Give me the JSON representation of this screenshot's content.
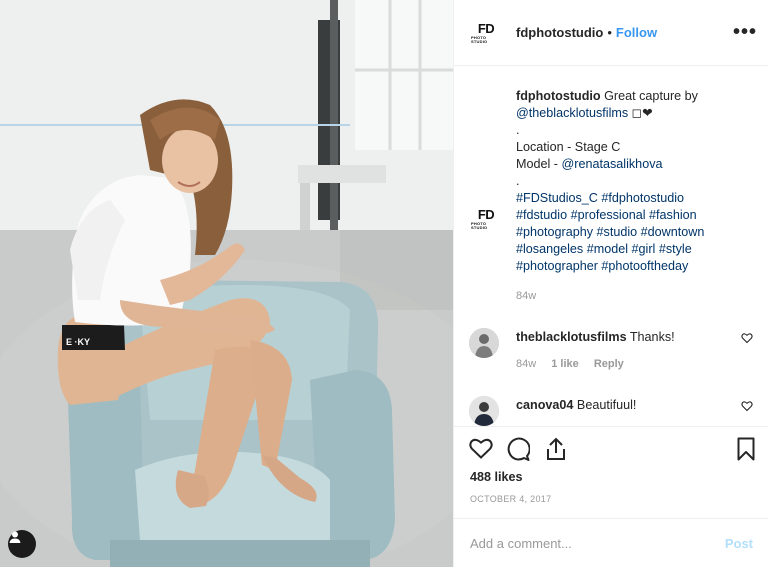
{
  "post": {
    "username": "fdphotostudio",
    "separator": "•",
    "follow_label": "Follow",
    "more_icon": "•••",
    "logo": {
      "big": "FD",
      "small": "PHOTO STUDIO"
    }
  },
  "caption": {
    "username": "fdphotostudio",
    "text_start": " Great capture by",
    "mention": "@theblacklotusfilms",
    "emoji": " ◻❤",
    "dot1": ".",
    "location": "Location - Stage C",
    "model_label": "Model - ",
    "model_mention": "@renatasalikhova",
    "dot2": ".",
    "hashtag_lines": [
      "#FDStudios_C #fdphotostudio",
      "#fdstudio #professional #fashion",
      "#photography #studio #downtown",
      "#losangeles #model #girl #style",
      "#photographer #photooftheday"
    ],
    "age": "84w"
  },
  "comments": [
    {
      "username": "theblacklotusfilms",
      "text": "Thanks!",
      "age": "84w",
      "likes": "1 like",
      "reply": "Reply"
    },
    {
      "username": "canova04",
      "text": "Beautifuul!"
    }
  ],
  "actions": {
    "icons": [
      "heart-icon",
      "comment-icon",
      "share-icon",
      "bookmark-icon"
    ],
    "likes": "488 likes",
    "date": "OCTOBER 4, 2017"
  },
  "add_comment": {
    "placeholder": "Add a comment...",
    "post_label": "Post"
  },
  "colors": {
    "link": "#3897f0",
    "mention": "#003569",
    "muted": "#999999",
    "border": "#efefef"
  }
}
